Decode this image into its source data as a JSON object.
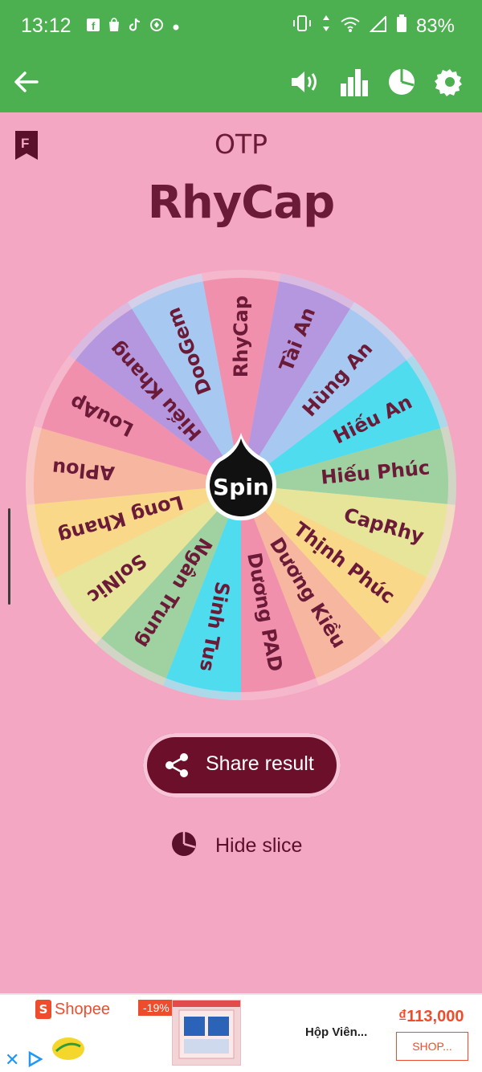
{
  "status_bar": {
    "time": "13:12",
    "battery": "83%",
    "left_icons": [
      "facebook-icon",
      "shopping-bag-icon",
      "tiktok-icon",
      "app-icon",
      "dot-icon"
    ],
    "right_icons": [
      "vibrate-icon",
      "data-arrows-icon",
      "wifi-icon",
      "signal-icon",
      "battery-icon"
    ]
  },
  "toolbar": {
    "icons": [
      "back-arrow-icon",
      "sound-icon",
      "stats-icon",
      "pie-icon",
      "settings-icon"
    ]
  },
  "wheel": {
    "caption": "OTP",
    "result": "RhyCap",
    "spin_label": "Spin",
    "slices": [
      {
        "label": "RhyCap",
        "color": "#f190ad"
      },
      {
        "label": "Tài An",
        "color": "#b497de"
      },
      {
        "label": "Hùng An",
        "color": "#a7c8f0"
      },
      {
        "label": "Hiếu An",
        "color": "#4fdcef"
      },
      {
        "label": "Hiếu Phúc",
        "color": "#9fd2a0"
      },
      {
        "label": "CapRhy",
        "color": "#e6e59a"
      },
      {
        "label": "Thịnh Phúc",
        "color": "#f9d889"
      },
      {
        "label": "Dương Kiều",
        "color": "#f6b6a0"
      },
      {
        "label": "Dương PAD",
        "color": "#f190ad"
      },
      {
        "label": "Sinh Tus",
        "color": "#4fdcef"
      },
      {
        "label": "Ngân Trung",
        "color": "#9fd2a0"
      },
      {
        "label": "SolNic",
        "color": "#e6e59a"
      },
      {
        "label": "Long Khang",
        "color": "#f9d889"
      },
      {
        "label": "APlou",
        "color": "#f6b6a0"
      },
      {
        "label": "LouAp",
        "color": "#f190ad"
      },
      {
        "label": "Hiếu Khang",
        "color": "#b497de"
      },
      {
        "label": "DooGem",
        "color": "#a7c8f0"
      }
    ],
    "text_color": "#6b1b37"
  },
  "actions": {
    "share_label": "Share result",
    "hide_label": "Hide slice"
  },
  "ad": {
    "shop_name": "Shopee",
    "shop_icon_letter": "S",
    "discount": "-19%",
    "product_name": "Hộp Viên...",
    "price": "₫113,000",
    "cta": "SHOP...",
    "close": "✕",
    "brand_logo": "Sunlight"
  }
}
